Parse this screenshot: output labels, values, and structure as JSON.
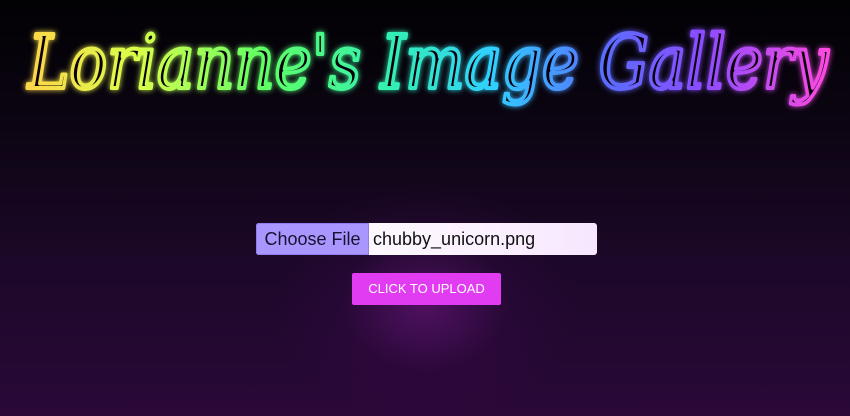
{
  "header": {
    "title": "Lorianne's Image Gallery",
    "gradient_colors": [
      "#ffd54a",
      "#d8ff4a",
      "#5dff66",
      "#33f0b0",
      "#2fd0ff",
      "#5a6dff",
      "#8a4dff",
      "#ff4adf"
    ]
  },
  "upload_form": {
    "choose_file_label": "Choose File",
    "selected_file_name": "chubby_unicorn.png",
    "upload_button_label": "CLICK TO UPLOAD"
  },
  "colors": {
    "choose_file_bg": "#a997ff",
    "upload_button_bg": "#e23cf2",
    "background_glow": "#7a188c"
  }
}
